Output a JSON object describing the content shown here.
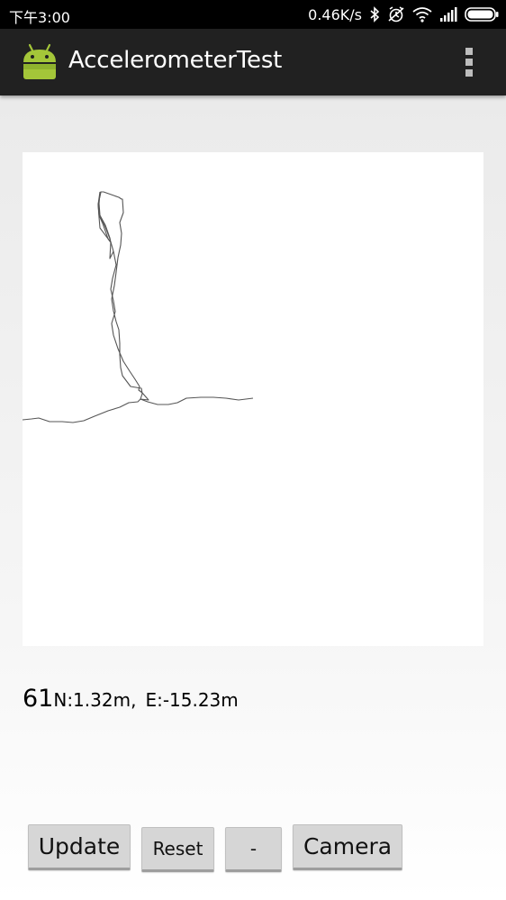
{
  "status_bar": {
    "time": "下午3:00",
    "net_speed": "0.46K/s",
    "icons": [
      "bluetooth-icon",
      "alarm-off-icon",
      "wifi-icon",
      "signal-icon",
      "battery-icon"
    ]
  },
  "action_bar": {
    "title": "AccelerometerTest",
    "icon": "android-robot-icon",
    "menu_icon": "overflow-menu-icon",
    "background": "#212121"
  },
  "track": {
    "background": "#ffffff",
    "line_color": "#555555"
  },
  "readout": {
    "count": "61",
    "north": "N:1.32m,",
    "east": "E:-15.23m"
  },
  "buttons": {
    "update": "Update",
    "reset": "Reset",
    "minus": "-",
    "camera": "Camera"
  },
  "colors": {
    "android_green": "#a4c639"
  }
}
